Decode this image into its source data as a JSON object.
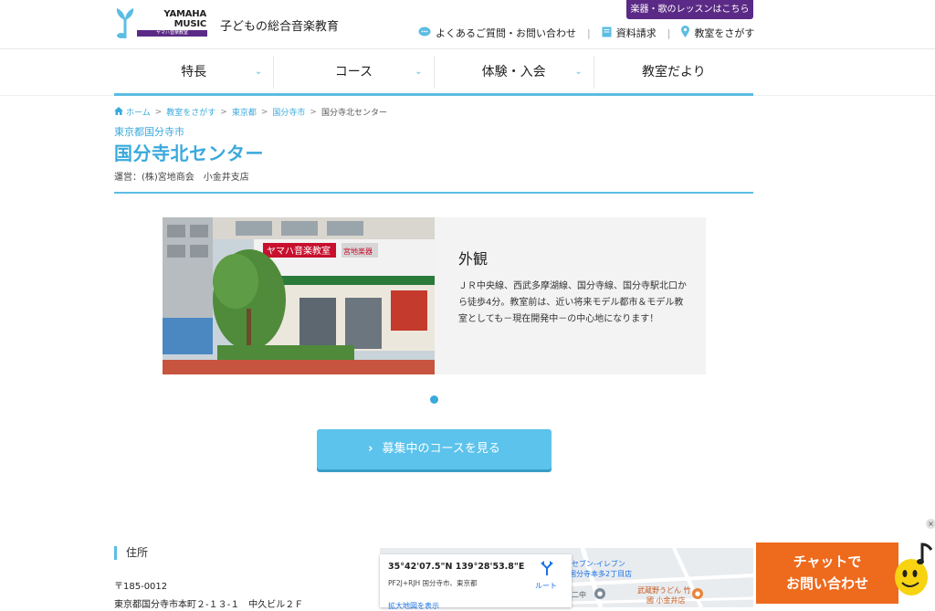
{
  "header": {
    "logo_line1": "YAMAHA",
    "logo_line2": "MUSIC SCHOOL",
    "logo_sub": "ヤマハ音楽教室",
    "tagline": "子どもの総合音楽教育",
    "lesson_button": "楽器・歌のレッスンはこちら",
    "links": [
      {
        "label": "よくあるご質問・お問い合わせ",
        "icon": "chat-bubble-icon"
      },
      {
        "label": "資料請求",
        "icon": "document-icon"
      },
      {
        "label": "教室をさがす",
        "icon": "map-pin-icon"
      }
    ]
  },
  "nav": {
    "items": [
      {
        "label": "特長",
        "has_dropdown": true
      },
      {
        "label": "コース",
        "has_dropdown": true
      },
      {
        "label": "体験・入会",
        "has_dropdown": true
      },
      {
        "label": "教室だより",
        "has_dropdown": false
      }
    ]
  },
  "breadcrumb": [
    "ホーム",
    "教室をさがす",
    "東京都",
    "国分寺市",
    "国分寺北センター"
  ],
  "page": {
    "prefecture_city": "東京都国分寺市",
    "title": "国分寺北センター",
    "operator": "運営：(株)宮地商会　小金井支店"
  },
  "slide": {
    "heading": "外観",
    "text": "ＪＲ中央線、西武多摩湖線、国分寺線、国分寺駅北口から徒歩4分。教室前は、近い将来モデル都市＆モデル教室としても－現在開発中－の中心地になります！",
    "sign_text": "ヤマハ音楽教室",
    "shop_sign": "宮地楽器"
  },
  "course_button": "募集中のコースを見る",
  "address": {
    "label": "住所",
    "zip": "〒185-0012",
    "line": "東京都国分寺市本町２-１３-１　中久ビル２Ｆ"
  },
  "map": {
    "coords": "35°42'07.5\"N 139°28'53.8\"E",
    "plus_code": "PF2J+RJH 国分寺市、東京都",
    "route_label": "ルート",
    "larger_map": "拡大地図を表示",
    "labels": [
      "セブン-イレブン",
      "国分寺本多2丁目店",
      "二中",
      "武蔵野うどん 竹",
      "國 小金井店"
    ]
  },
  "chat": {
    "line1": "チャットで",
    "line2": "お問い合わせ"
  },
  "colors": {
    "accent": "#3aa9dc",
    "brand_purple": "#5b2a86",
    "chat_orange": "#ee6a1c"
  }
}
